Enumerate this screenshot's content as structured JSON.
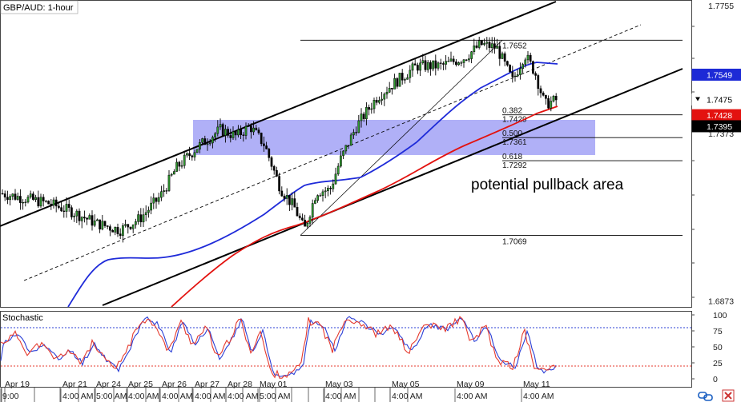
{
  "chart_data": {
    "type": "candlestick",
    "title": "GBP/AUD: 1-hour",
    "annotation": "potential pullback area",
    "indicator_title": "Stochastic",
    "y_range": [
      1.686,
      1.7765
    ],
    "price_ticks": [
      {
        "value": 1.7755,
        "label": "1.7755"
      },
      {
        "value": 1.7373,
        "label": "1.7373"
      },
      {
        "value": 1.6873,
        "label": "1.6873"
      }
    ],
    "price_tags": [
      {
        "value": 1.7549,
        "label": "1.7549",
        "style": "blue"
      },
      {
        "value": 1.7475,
        "label": "1.7475",
        "style": "white"
      },
      {
        "value": 1.7428,
        "label": "1.7428",
        "style": "red"
      },
      {
        "value": 1.7395,
        "label": "1.7395",
        "style": "black"
      }
    ],
    "x_labels": [
      "9:00",
      "Apr 19",
      "4:00 AM",
      "Apr 21",
      "5:00 AM",
      "Apr 24",
      "4:00 AM",
      "Apr 25",
      "4:00 AM",
      "Apr 26",
      "4:00 AM",
      "Apr 27",
      "4:00 AM",
      "Apr 28",
      "5:00 AM",
      "May 01",
      "4:00 AM",
      "May 03",
      "4:00 AM",
      "May 05",
      "4:00 AM",
      "May 09",
      "4:00 AM",
      "May 11",
      "4:00 AM"
    ],
    "fibonacci": {
      "high": 1.7652,
      "low": 1.7069,
      "levels": [
        {
          "ratio": "0.382",
          "price": "1.7429"
        },
        {
          "ratio": "0.500",
          "price": "1.7361"
        },
        {
          "ratio": "0.618",
          "price": "1.7292"
        }
      ],
      "high_label": "1.7652",
      "low_label": "1.7069"
    },
    "zone": {
      "from": 1.7309,
      "to": 1.7414
    },
    "series": [
      {
        "name": "price",
        "type": "candle",
        "color": "#000000"
      },
      {
        "name": "sma_blue",
        "color": "#1f2bd9"
      },
      {
        "name": "sma_red",
        "color": "#e3120f"
      }
    ],
    "stochastic": {
      "y_ticks": [
        100,
        75,
        50,
        25,
        0
      ],
      "levels": [
        80,
        20
      ],
      "k_color": "#e53a2e",
      "d_color": "#2b3fd6"
    }
  }
}
